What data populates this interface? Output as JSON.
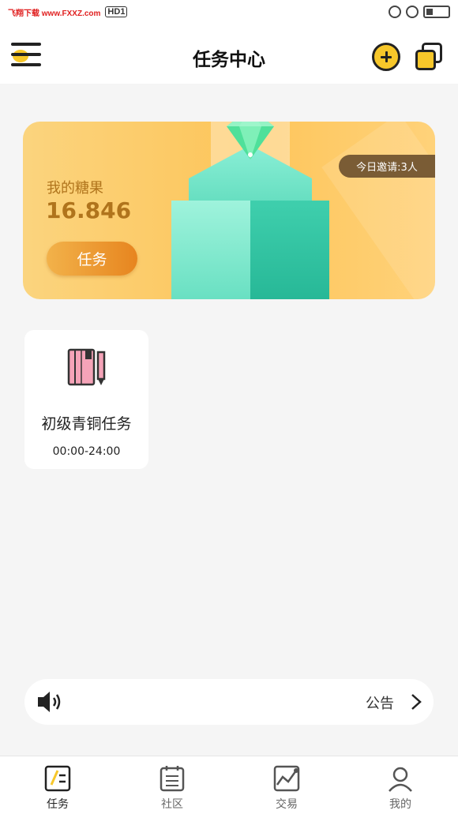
{
  "status_bar": {
    "watermark": "飞翔下载 www.FXXZ.com",
    "hd_label": "HD",
    "hd_sub": "1"
  },
  "header": {
    "title": "任务中心",
    "menu_icon": "menu-icon",
    "add_icon": "add-circle-icon",
    "copy_icon": "copy-icon"
  },
  "banner": {
    "label": "我的糖果",
    "value": "16.846",
    "button_label": "任务",
    "invite_text": "今日邀请:3人"
  },
  "tasks": [
    {
      "title": "初级青铜任务",
      "time": "00:00-24:00",
      "icon": "book-pencil-icon"
    }
  ],
  "notice": {
    "label": "公告",
    "icon": "speaker-icon"
  },
  "tabbar": {
    "items": [
      {
        "label": "任务",
        "icon": "task-icon",
        "active": true
      },
      {
        "label": "社区",
        "icon": "calendar-icon",
        "active": false
      },
      {
        "label": "交易",
        "icon": "chart-icon",
        "active": false
      },
      {
        "label": "我的",
        "icon": "profile-icon",
        "active": false
      }
    ]
  },
  "colors": {
    "accent": "#f7c72a",
    "banner_text": "#b0741c",
    "task_button": "#e7851f",
    "invite_badge": "#7a5c35"
  }
}
